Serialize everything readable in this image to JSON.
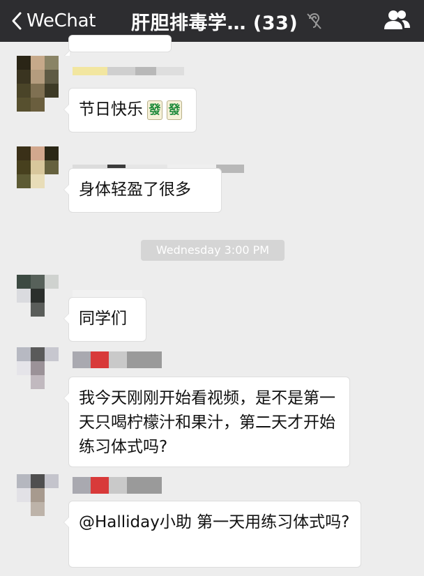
{
  "nav": {
    "back_label": "WeChat",
    "title": "肝胆排毒学… (33)",
    "mute_icon": "ear-muted-icon",
    "members_icon": "group-members-icon"
  },
  "messages": [
    {
      "text": "节日快乐",
      "emoji": [
        "發",
        "發"
      ]
    },
    {
      "text": "身体轻盈了很多"
    },
    {
      "timestamp": "Wednesday 3:00 PM"
    },
    {
      "text": "同学们"
    },
    {
      "text": "我今天刚刚开始看视频，是不是第一天只喝柠檬汁和果汁，第二天才开始练习体式吗?"
    },
    {
      "text": "@Halliday小助 第一天用练习体式吗?"
    }
  ],
  "colors": {
    "nav_background": "#2d2d30",
    "chat_background": "#ededed",
    "bubble": "#ffffff",
    "timestamp_background": "#d5d5d5"
  }
}
